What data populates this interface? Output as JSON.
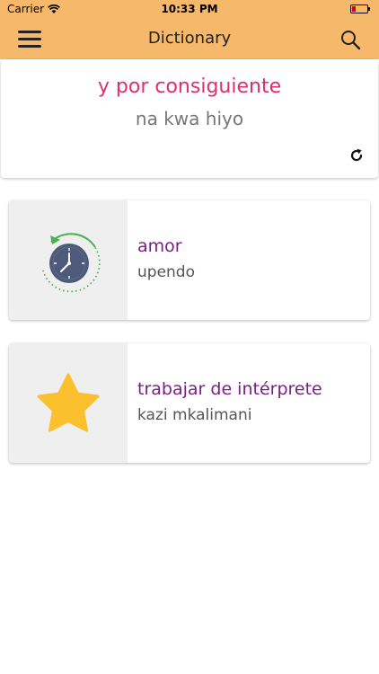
{
  "status": {
    "carrier": "Carrier",
    "time": "10:33 PM"
  },
  "header": {
    "title": "Dictionary"
  },
  "translation": {
    "source": "y por consiguiente",
    "target": "na kwa hiyo"
  },
  "entries": [
    {
      "word": "amor",
      "translation": "upendo",
      "icon": "history-clock-icon"
    },
    {
      "word": "trabajar de intérprete",
      "translation": "kazi mkalimani",
      "icon": "star-icon"
    }
  ],
  "colors": {
    "header_bg": "#f6b86a",
    "source_text": "#e0306a",
    "entry_word": "#7a1e86",
    "star": "#fbc02d",
    "clock_face": "#4d5a7a",
    "history_ring": "#4caf50"
  }
}
